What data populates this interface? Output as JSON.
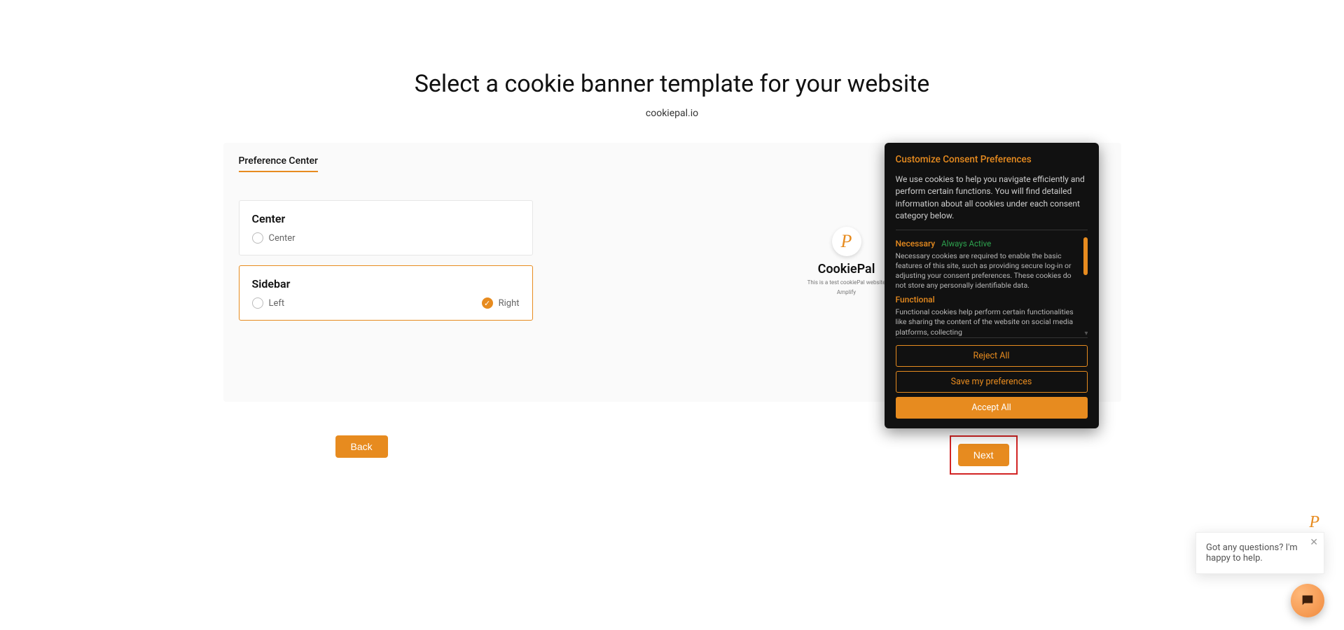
{
  "header": {
    "title": "Select a cookie banner template for your website",
    "domain": "cookiepal.io"
  },
  "tabs": {
    "active": "Preference Center"
  },
  "options": {
    "center": {
      "title": "Center",
      "radios": {
        "center": "Center"
      },
      "selected": false
    },
    "sidebar": {
      "title": "Sidebar",
      "radios": {
        "left": "Left",
        "right": "Right"
      },
      "selected": true,
      "checked": "right"
    }
  },
  "sample": {
    "logo_letter": "P",
    "title": "CookiePal",
    "line1": "This is a test cookiePal website",
    "line2": "Amplify"
  },
  "consent": {
    "title": "Customize Consent Preferences",
    "intro": "We use cookies to help you navigate efficiently and perform certain functions. You will find detailed information about all cookies under each consent category below.",
    "categories": [
      {
        "name": "Necessary",
        "status": "Always Active",
        "desc": "Necessary cookies are required to enable the basic features of this site, such as providing secure log-in or adjusting your consent preferences. These cookies do not store any personally identifiable data."
      },
      {
        "name": "Functional",
        "status": "",
        "desc": "Functional cookies help perform certain functionalities like sharing the content of the website on social media platforms, collecting"
      }
    ],
    "buttons": {
      "reject": "Reject All",
      "save": "Save my preferences",
      "accept": "Accept All"
    }
  },
  "nav": {
    "back": "Back",
    "next": "Next"
  },
  "chat": {
    "logo_letter": "P",
    "message": "Got any questions? I'm happy to help."
  }
}
